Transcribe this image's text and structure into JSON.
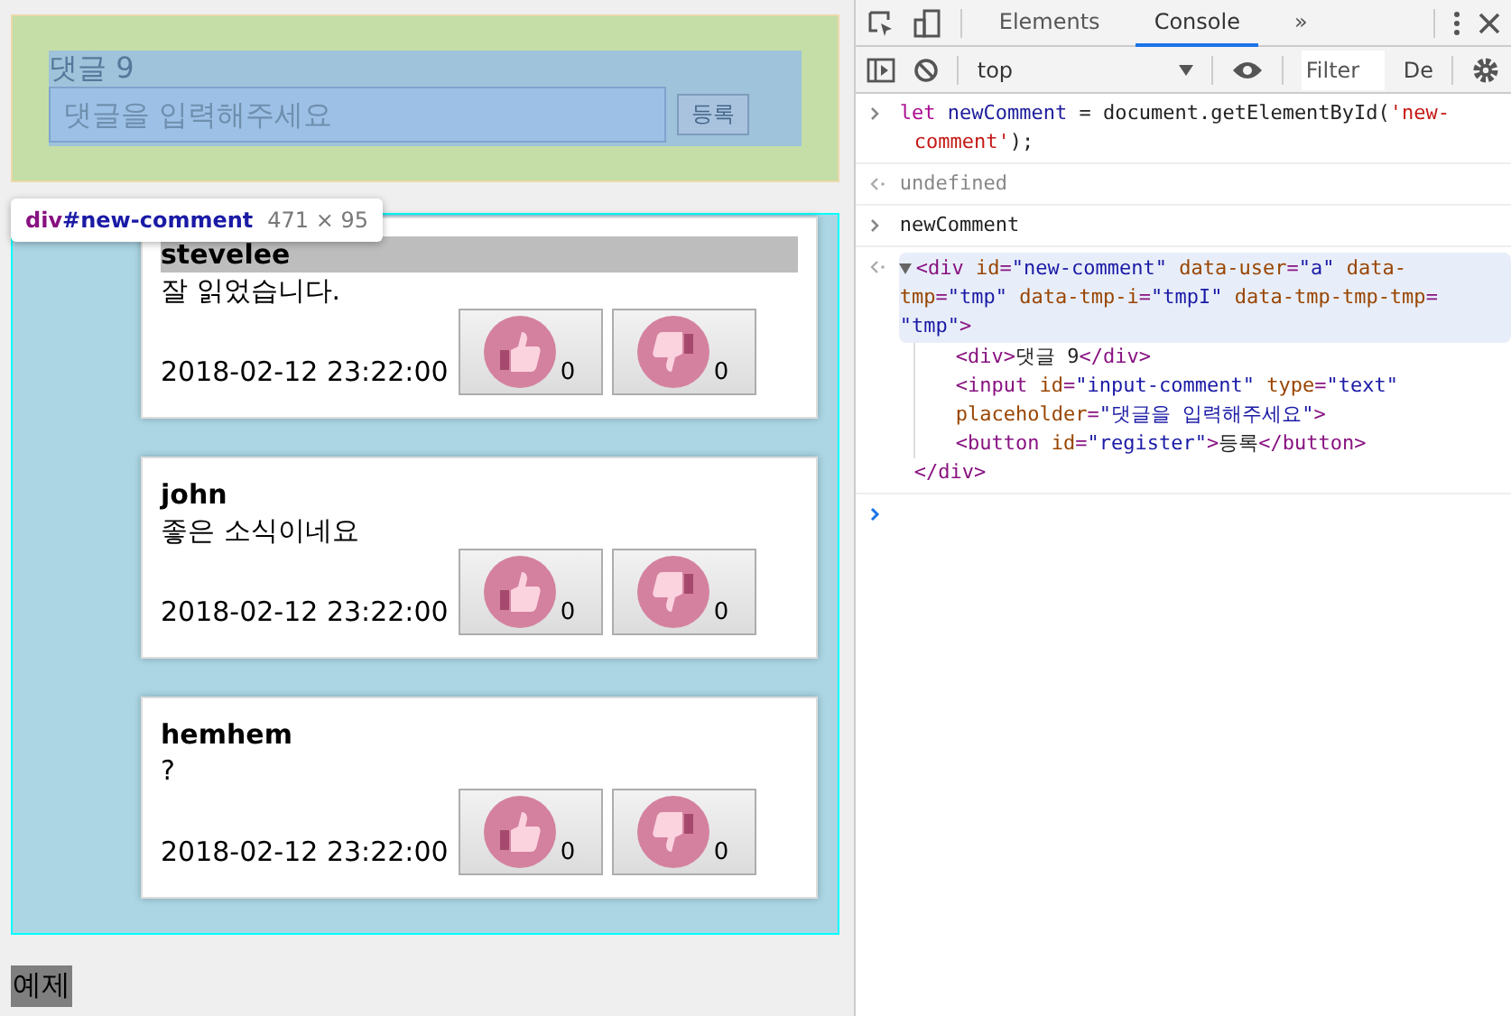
{
  "page": {
    "new_comment": {
      "count_label": "댓글 9",
      "placeholder": "댓글을 입력해주세요",
      "submit": "등록"
    },
    "inspect_tooltip": {
      "tag": "div",
      "id": "#new-comment",
      "size": "471 × 95"
    },
    "comments": [
      {
        "author": "stevelee",
        "highlighted": true,
        "text": "잘 읽었습니다.",
        "date": "2018-02-12 23:22:00",
        "likes": "0",
        "dislikes": "0"
      },
      {
        "author": "john",
        "highlighted": false,
        "text": "좋은 소식이네요",
        "date": "2018-02-12 23:22:00",
        "likes": "0",
        "dislikes": "0"
      },
      {
        "author": "hemhem",
        "highlighted": false,
        "text": "?",
        "date": "2018-02-12 23:22:00",
        "likes": "0",
        "dislikes": "0"
      }
    ],
    "footer_label": "예제"
  },
  "devtools": {
    "tabs": [
      {
        "label": "Elements",
        "selected": false
      },
      {
        "label": "Console",
        "selected": true
      }
    ],
    "more_tabs": "»",
    "context": "top",
    "filter_placeholder": "Filter",
    "levels": "De",
    "console": [
      {
        "kind": "input",
        "lines": [
          [
            {
              "kind": "kw",
              "text": "let "
            },
            {
              "kind": "var",
              "text": "newComment"
            },
            {
              "kind": "plain",
              "text": " = document.getElementById("
            },
            {
              "kind": "str",
              "text": "'new-"
            }
          ],
          [
            {
              "kind": "str",
              "text": "comment'"
            },
            {
              "kind": "plain",
              "text": ");"
            }
          ]
        ]
      },
      {
        "kind": "result",
        "lines": [
          [
            {
              "kind": "muted",
              "text": "undefined"
            }
          ]
        ]
      },
      {
        "kind": "input",
        "lines": [
          [
            {
              "kind": "plain",
              "text": "newComment"
            }
          ]
        ]
      },
      {
        "kind": "element",
        "lines": [
          [
            {
              "kind": "tag",
              "text": "<div "
            },
            {
              "kind": "attr",
              "text": "id"
            },
            {
              "kind": "tag",
              "text": "="
            },
            {
              "kind": "val",
              "text": "\"new-comment\" "
            },
            {
              "kind": "attr",
              "text": "data-user"
            },
            {
              "kind": "tag",
              "text": "="
            },
            {
              "kind": "val",
              "text": "\"a\" "
            },
            {
              "kind": "attr",
              "text": "data-"
            }
          ],
          [
            {
              "kind": "attr",
              "text": "tmp"
            },
            {
              "kind": "tag",
              "text": "="
            },
            {
              "kind": "val",
              "text": "\"tmp\" "
            },
            {
              "kind": "attr",
              "text": "data-tmp-i"
            },
            {
              "kind": "tag",
              "text": "="
            },
            {
              "kind": "val",
              "text": "\"tmpI\" "
            },
            {
              "kind": "attr",
              "text": "data-tmp-tmp-tmp"
            },
            {
              "kind": "tag",
              "text": "="
            }
          ],
          [
            {
              "kind": "val",
              "text": "\"tmp\""
            },
            {
              "kind": "tag",
              "text": ">"
            }
          ]
        ],
        "children": [
          [
            {
              "kind": "tag",
              "text": "<div>"
            },
            {
              "kind": "plain",
              "text": "댓글 9"
            },
            {
              "kind": "tag",
              "text": "</div>"
            }
          ],
          [
            {
              "kind": "tag",
              "text": "<input "
            },
            {
              "kind": "attr",
              "text": "id"
            },
            {
              "kind": "tag",
              "text": "="
            },
            {
              "kind": "val",
              "text": "\"input-comment\" "
            },
            {
              "kind": "attr",
              "text": "type"
            },
            {
              "kind": "tag",
              "text": "="
            },
            {
              "kind": "val",
              "text": "\"text\""
            }
          ],
          [
            {
              "kind": "attr",
              "text": "placeholder"
            },
            {
              "kind": "tag",
              "text": "="
            },
            {
              "kind": "val",
              "text": "\"댓글을 입력해주세요\""
            },
            {
              "kind": "tag",
              "text": ">"
            }
          ],
          [
            {
              "kind": "tag",
              "text": "<button "
            },
            {
              "kind": "attr",
              "text": "id"
            },
            {
              "kind": "tag",
              "text": "="
            },
            {
              "kind": "val",
              "text": "\"register\""
            },
            {
              "kind": "tag",
              "text": ">"
            },
            {
              "kind": "plain",
              "text": "등록"
            },
            {
              "kind": "tag",
              "text": "</button>"
            }
          ]
        ],
        "closing": [
          {
            "kind": "tag",
            "text": "</div>"
          }
        ]
      },
      {
        "kind": "prompt"
      }
    ]
  }
}
